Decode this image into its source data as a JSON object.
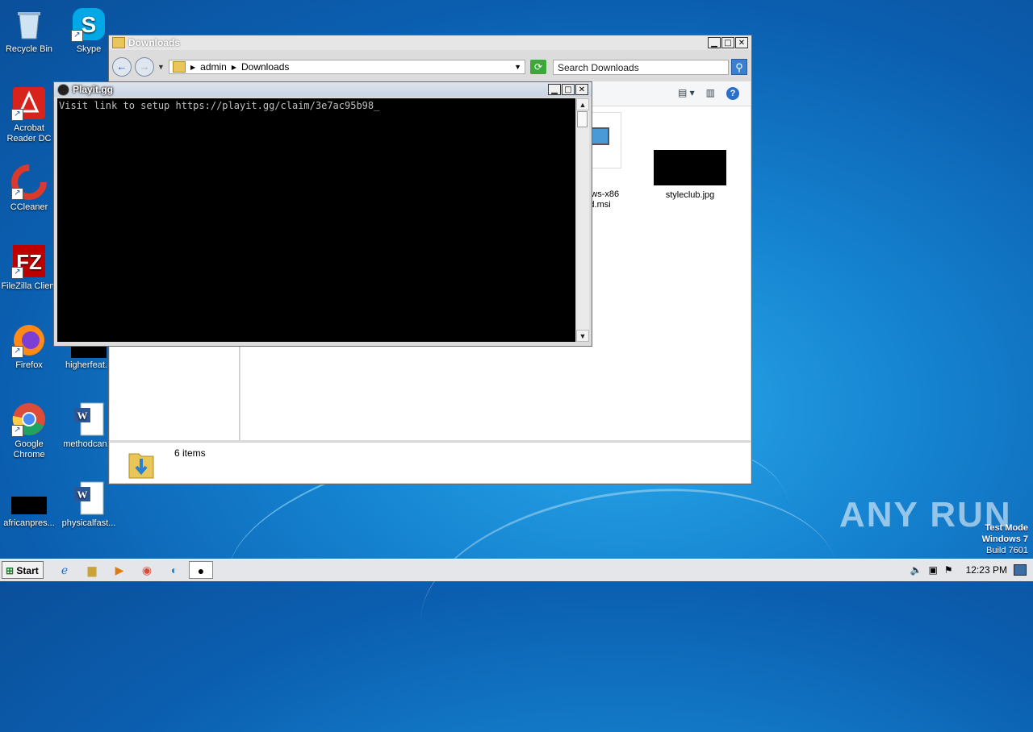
{
  "desktop": {
    "icons": [
      {
        "label": "Recycle Bin"
      },
      {
        "label": "Skype"
      },
      {
        "label": "Acrobat Reader DC"
      },
      {
        "label": "CCleaner"
      },
      {
        "label": "FileZilla Client"
      },
      {
        "label": "Firefox"
      },
      {
        "label": "higherfeat..."
      },
      {
        "label": "Google Chrome"
      },
      {
        "label": "methodcan..."
      },
      {
        "label": "africanpres..."
      },
      {
        "label": "physicalfast..."
      }
    ],
    "watermark": {
      "line1": "Test Mode",
      "line2": "Windows 7",
      "line3": "Build 7601"
    },
    "brand": "ANY RUN"
  },
  "explorer": {
    "title": "Downloads",
    "breadcrumb": [
      "admin",
      "Downloads"
    ],
    "search_placeholder": "Search Downloads",
    "files": [
      {
        "name": "...dows-x86",
        "name2": "...d.msi"
      },
      {
        "name": "styleclub.jpg"
      }
    ],
    "status": "6 items"
  },
  "console": {
    "title": "Playit.gg",
    "text": "Visit link to setup https://playit.gg/claim/3e7ac95b98_"
  },
  "taskbar": {
    "start_label": "Start",
    "clock": "12:23 PM"
  }
}
